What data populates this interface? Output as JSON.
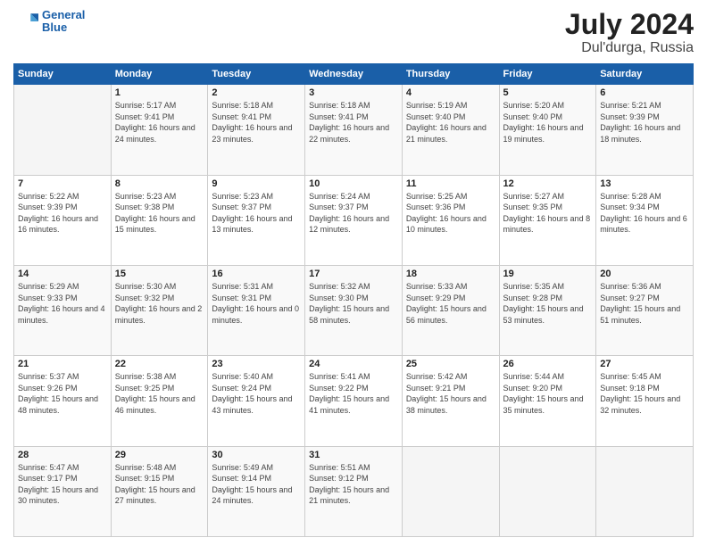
{
  "logo": {
    "line1": "General",
    "line2": "Blue"
  },
  "title": "July 2024",
  "subtitle": "Dul'durga, Russia",
  "header_days": [
    "Sunday",
    "Monday",
    "Tuesday",
    "Wednesday",
    "Thursday",
    "Friday",
    "Saturday"
  ],
  "weeks": [
    [
      {
        "day": "",
        "sunrise": "",
        "sunset": "",
        "daylight": ""
      },
      {
        "day": "1",
        "sunrise": "Sunrise: 5:17 AM",
        "sunset": "Sunset: 9:41 PM",
        "daylight": "Daylight: 16 hours and 24 minutes."
      },
      {
        "day": "2",
        "sunrise": "Sunrise: 5:18 AM",
        "sunset": "Sunset: 9:41 PM",
        "daylight": "Daylight: 16 hours and 23 minutes."
      },
      {
        "day": "3",
        "sunrise": "Sunrise: 5:18 AM",
        "sunset": "Sunset: 9:41 PM",
        "daylight": "Daylight: 16 hours and 22 minutes."
      },
      {
        "day": "4",
        "sunrise": "Sunrise: 5:19 AM",
        "sunset": "Sunset: 9:40 PM",
        "daylight": "Daylight: 16 hours and 21 minutes."
      },
      {
        "day": "5",
        "sunrise": "Sunrise: 5:20 AM",
        "sunset": "Sunset: 9:40 PM",
        "daylight": "Daylight: 16 hours and 19 minutes."
      },
      {
        "day": "6",
        "sunrise": "Sunrise: 5:21 AM",
        "sunset": "Sunset: 9:39 PM",
        "daylight": "Daylight: 16 hours and 18 minutes."
      }
    ],
    [
      {
        "day": "7",
        "sunrise": "Sunrise: 5:22 AM",
        "sunset": "Sunset: 9:39 PM",
        "daylight": "Daylight: 16 hours and 16 minutes."
      },
      {
        "day": "8",
        "sunrise": "Sunrise: 5:23 AM",
        "sunset": "Sunset: 9:38 PM",
        "daylight": "Daylight: 16 hours and 15 minutes."
      },
      {
        "day": "9",
        "sunrise": "Sunrise: 5:23 AM",
        "sunset": "Sunset: 9:37 PM",
        "daylight": "Daylight: 16 hours and 13 minutes."
      },
      {
        "day": "10",
        "sunrise": "Sunrise: 5:24 AM",
        "sunset": "Sunset: 9:37 PM",
        "daylight": "Daylight: 16 hours and 12 minutes."
      },
      {
        "day": "11",
        "sunrise": "Sunrise: 5:25 AM",
        "sunset": "Sunset: 9:36 PM",
        "daylight": "Daylight: 16 hours and 10 minutes."
      },
      {
        "day": "12",
        "sunrise": "Sunrise: 5:27 AM",
        "sunset": "Sunset: 9:35 PM",
        "daylight": "Daylight: 16 hours and 8 minutes."
      },
      {
        "day": "13",
        "sunrise": "Sunrise: 5:28 AM",
        "sunset": "Sunset: 9:34 PM",
        "daylight": "Daylight: 16 hours and 6 minutes."
      }
    ],
    [
      {
        "day": "14",
        "sunrise": "Sunrise: 5:29 AM",
        "sunset": "Sunset: 9:33 PM",
        "daylight": "Daylight: 16 hours and 4 minutes."
      },
      {
        "day": "15",
        "sunrise": "Sunrise: 5:30 AM",
        "sunset": "Sunset: 9:32 PM",
        "daylight": "Daylight: 16 hours and 2 minutes."
      },
      {
        "day": "16",
        "sunrise": "Sunrise: 5:31 AM",
        "sunset": "Sunset: 9:31 PM",
        "daylight": "Daylight: 16 hours and 0 minutes."
      },
      {
        "day": "17",
        "sunrise": "Sunrise: 5:32 AM",
        "sunset": "Sunset: 9:30 PM",
        "daylight": "Daylight: 15 hours and 58 minutes."
      },
      {
        "day": "18",
        "sunrise": "Sunrise: 5:33 AM",
        "sunset": "Sunset: 9:29 PM",
        "daylight": "Daylight: 15 hours and 56 minutes."
      },
      {
        "day": "19",
        "sunrise": "Sunrise: 5:35 AM",
        "sunset": "Sunset: 9:28 PM",
        "daylight": "Daylight: 15 hours and 53 minutes."
      },
      {
        "day": "20",
        "sunrise": "Sunrise: 5:36 AM",
        "sunset": "Sunset: 9:27 PM",
        "daylight": "Daylight: 15 hours and 51 minutes."
      }
    ],
    [
      {
        "day": "21",
        "sunrise": "Sunrise: 5:37 AM",
        "sunset": "Sunset: 9:26 PM",
        "daylight": "Daylight: 15 hours and 48 minutes."
      },
      {
        "day": "22",
        "sunrise": "Sunrise: 5:38 AM",
        "sunset": "Sunset: 9:25 PM",
        "daylight": "Daylight: 15 hours and 46 minutes."
      },
      {
        "day": "23",
        "sunrise": "Sunrise: 5:40 AM",
        "sunset": "Sunset: 9:24 PM",
        "daylight": "Daylight: 15 hours and 43 minutes."
      },
      {
        "day": "24",
        "sunrise": "Sunrise: 5:41 AM",
        "sunset": "Sunset: 9:22 PM",
        "daylight": "Daylight: 15 hours and 41 minutes."
      },
      {
        "day": "25",
        "sunrise": "Sunrise: 5:42 AM",
        "sunset": "Sunset: 9:21 PM",
        "daylight": "Daylight: 15 hours and 38 minutes."
      },
      {
        "day": "26",
        "sunrise": "Sunrise: 5:44 AM",
        "sunset": "Sunset: 9:20 PM",
        "daylight": "Daylight: 15 hours and 35 minutes."
      },
      {
        "day": "27",
        "sunrise": "Sunrise: 5:45 AM",
        "sunset": "Sunset: 9:18 PM",
        "daylight": "Daylight: 15 hours and 32 minutes."
      }
    ],
    [
      {
        "day": "28",
        "sunrise": "Sunrise: 5:47 AM",
        "sunset": "Sunset: 9:17 PM",
        "daylight": "Daylight: 15 hours and 30 minutes."
      },
      {
        "day": "29",
        "sunrise": "Sunrise: 5:48 AM",
        "sunset": "Sunset: 9:15 PM",
        "daylight": "Daylight: 15 hours and 27 minutes."
      },
      {
        "day": "30",
        "sunrise": "Sunrise: 5:49 AM",
        "sunset": "Sunset: 9:14 PM",
        "daylight": "Daylight: 15 hours and 24 minutes."
      },
      {
        "day": "31",
        "sunrise": "Sunrise: 5:51 AM",
        "sunset": "Sunset: 9:12 PM",
        "daylight": "Daylight: 15 hours and 21 minutes."
      },
      {
        "day": "",
        "sunrise": "",
        "sunset": "",
        "daylight": ""
      },
      {
        "day": "",
        "sunrise": "",
        "sunset": "",
        "daylight": ""
      },
      {
        "day": "",
        "sunrise": "",
        "sunset": "",
        "daylight": ""
      }
    ]
  ]
}
